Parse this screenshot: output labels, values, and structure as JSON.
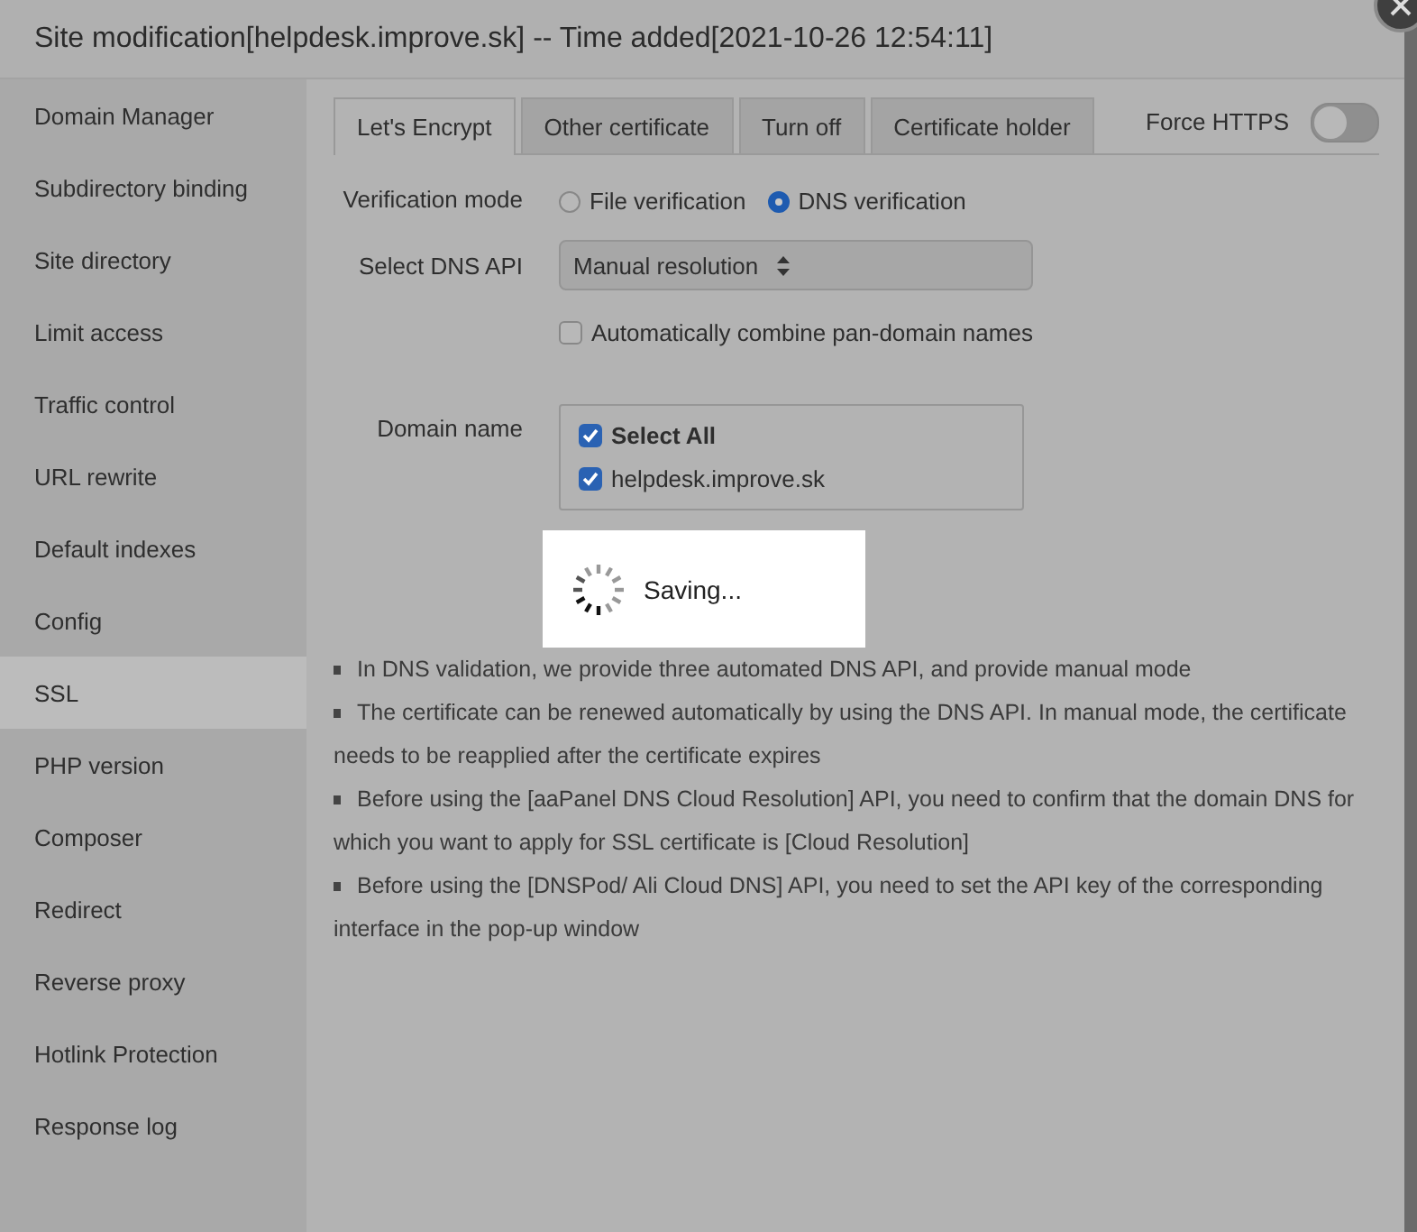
{
  "window": {
    "title": "Site modification[helpdesk.improve.sk] -- Time added[2021-10-26 12:54:11]"
  },
  "sidebar": {
    "items": [
      {
        "label": "Domain Manager",
        "selected": false
      },
      {
        "label": "Subdirectory binding",
        "selected": false
      },
      {
        "label": "Site directory",
        "selected": false
      },
      {
        "label": "Limit access",
        "selected": false
      },
      {
        "label": "Traffic control",
        "selected": false
      },
      {
        "label": "URL rewrite",
        "selected": false
      },
      {
        "label": "Default indexes",
        "selected": false
      },
      {
        "label": "Config",
        "selected": false
      },
      {
        "label": "SSL",
        "selected": true
      },
      {
        "label": "PHP version",
        "selected": false
      },
      {
        "label": "Composer",
        "selected": false
      },
      {
        "label": "Redirect",
        "selected": false
      },
      {
        "label": "Reverse proxy",
        "selected": false
      },
      {
        "label": "Hotlink Protection",
        "selected": false
      },
      {
        "label": "Response log",
        "selected": false
      }
    ]
  },
  "tabs": [
    {
      "label": "Let's Encrypt",
      "selected": true
    },
    {
      "label": "Other certificate",
      "selected": false
    },
    {
      "label": "Turn off",
      "selected": false
    },
    {
      "label": "Certificate holder",
      "selected": false
    }
  ],
  "force_https": {
    "label": "Force HTTPS",
    "on": false
  },
  "verification_mode": {
    "label": "Verification mode",
    "options": [
      {
        "label": "File verification",
        "selected": false
      },
      {
        "label": "DNS verification",
        "selected": true
      }
    ]
  },
  "dns_api": {
    "label": "Select DNS API",
    "value": "Manual resolution"
  },
  "combine": {
    "label": "Automatically combine pan-domain names",
    "checked": false
  },
  "domain_name": {
    "label": "Domain name",
    "items": [
      {
        "label": "Select All",
        "checked": true,
        "kind": "select_all"
      },
      {
        "label": "helpdesk.improve.sk",
        "checked": true,
        "kind": "domain"
      }
    ]
  },
  "loading": {
    "text": "Saving..."
  },
  "notes": [
    "In DNS validation, we provide three automated DNS API, and provide manual mode",
    "The certificate can be renewed automatically by using the DNS API. In manual mode, the certificate needs to be reapplied after the certificate expires",
    "Before using the [aaPanel DNS Cloud Resolution] API, you need to confirm that the domain DNS for which you want to apply for SSL certificate is [Cloud Resolution]",
    "Before using the [DNSPod/ Ali Cloud DNS] API, you need to set the API key of the corresponding interface in the pop-up window"
  ]
}
